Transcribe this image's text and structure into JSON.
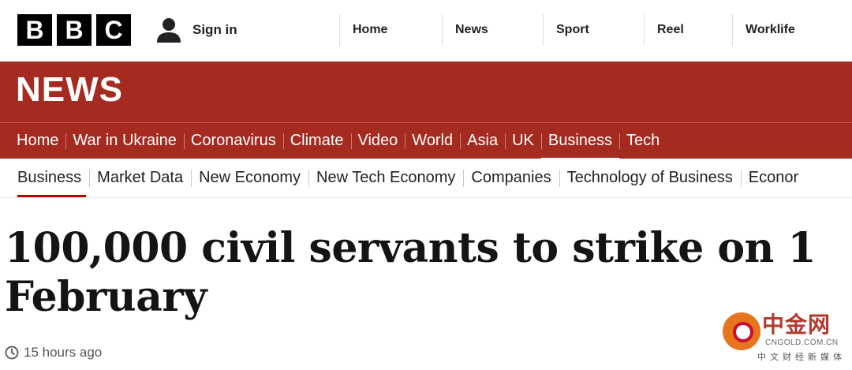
{
  "brand": {
    "logo_letters": [
      "B",
      "B",
      "C"
    ]
  },
  "account": {
    "signin_label": "Sign in"
  },
  "global_nav": {
    "items": [
      "Home",
      "News",
      "Sport",
      "Reel",
      "Worklife"
    ]
  },
  "news": {
    "wordmark": "NEWS",
    "nav_items": [
      "Home",
      "War in Ukraine",
      "Coronavirus",
      "Climate",
      "Video",
      "World",
      "Asia",
      "UK",
      "Business",
      "Tech"
    ],
    "active_item": "Business"
  },
  "sub_nav": {
    "items": [
      "Business",
      "Market Data",
      "New Economy",
      "New Tech Economy",
      "Companies",
      "Technology of Business",
      "Econor"
    ],
    "active_item": "Business"
  },
  "article": {
    "headline": "100,000 civil servants to strike on 1 February",
    "timestamp": "15 hours ago"
  },
  "watermark": {
    "title": "中金网",
    "url": "CNGOLD.COM.CN",
    "tagline": "中文财经新媒体"
  },
  "colors": {
    "news_red": "#a52a20",
    "active_underline": "#b80000"
  }
}
